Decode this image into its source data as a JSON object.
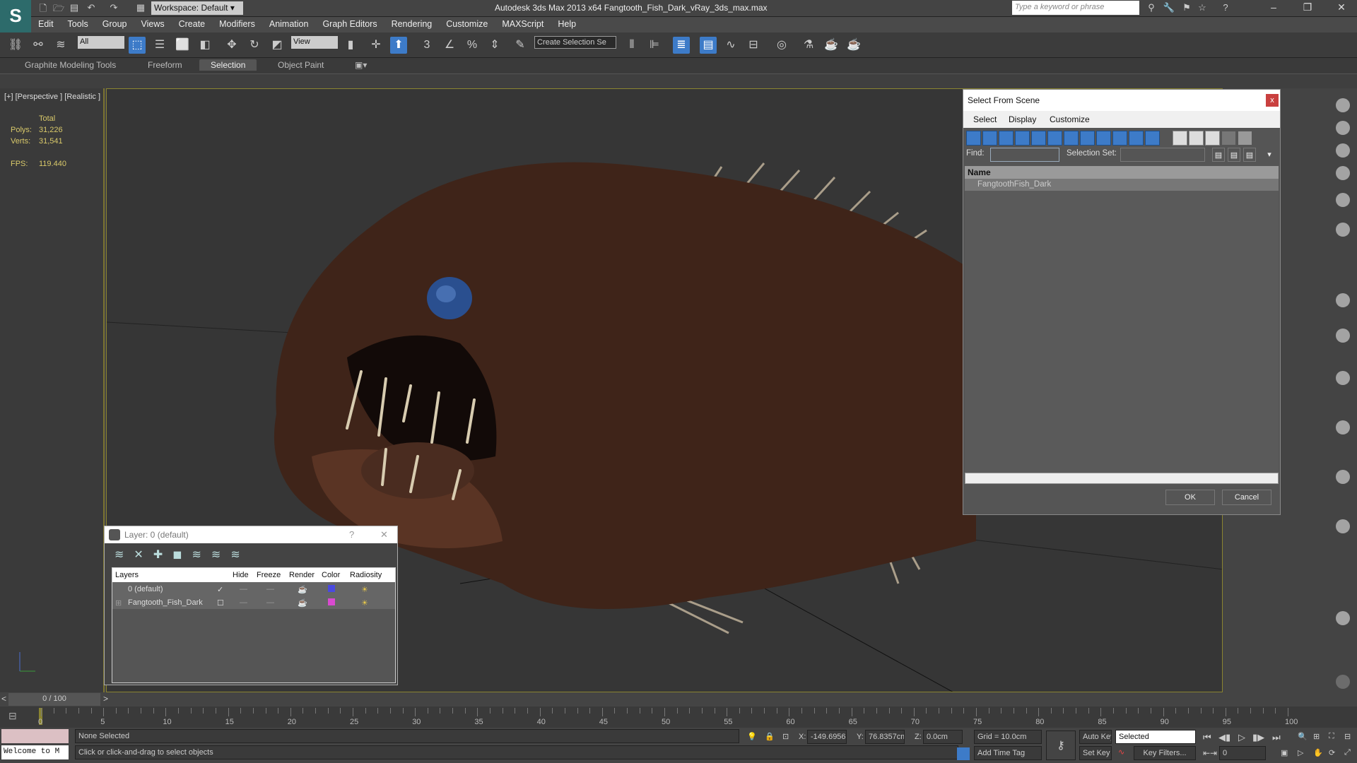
{
  "titlebar": {
    "workspace": "Workspace: Default",
    "title": "Autodesk 3ds Max  2013 x64     Fangtooth_Fish_Dark_vRay_3ds_max.max",
    "search_placeholder": "Type a keyword or phrase"
  },
  "menu": [
    "Edit",
    "Tools",
    "Group",
    "Views",
    "Create",
    "Modifiers",
    "Animation",
    "Graph Editors",
    "Rendering",
    "Customize",
    "MAXScript",
    "Help"
  ],
  "toolbar": {
    "filter": "All",
    "ref_coord": "View",
    "selection_set": "Create Selection Se"
  },
  "ribbon": {
    "tabs": [
      "Graphite Modeling Tools",
      "Freeform",
      "Selection",
      "Object Paint"
    ],
    "active": "Selection"
  },
  "viewport": {
    "label": "[+] [Perspective ] [Realistic ]",
    "stats": {
      "total": "Total",
      "polys_label": "Polys:",
      "polys": "31,226",
      "verts_label": "Verts:",
      "verts": "31,541",
      "fps_label": "FPS:",
      "fps": "119.440"
    }
  },
  "select_from_scene": {
    "title": "Select From Scene",
    "close": "x",
    "menu": [
      "Select",
      "Display",
      "Customize"
    ],
    "find_label": "Find:",
    "find_value": "",
    "selset_label": "Selection Set:",
    "column": "Name",
    "items": [
      "FangtoothFish_Dark"
    ],
    "ok": "OK",
    "cancel": "Cancel"
  },
  "layer_dialog": {
    "title": "Layer: 0 (default)",
    "help": "?",
    "close": "✕",
    "columns": [
      "Layers",
      "Hide",
      "Freeze",
      "Render",
      "Color",
      "Radiosity"
    ],
    "rows": [
      {
        "name": "0 (default)",
        "current": "✓",
        "color": "#4a4adf"
      },
      {
        "name": "Fangtooth_Fish_Dark",
        "current": "☐",
        "color": "#d94ad0"
      }
    ]
  },
  "timeline": {
    "frame": "0 / 100",
    "ticks": [
      "0",
      "5",
      "10",
      "15",
      "20",
      "25",
      "30",
      "35",
      "40",
      "45",
      "50",
      "55",
      "60",
      "65",
      "70",
      "75",
      "80",
      "85",
      "90",
      "95",
      "100"
    ]
  },
  "status": {
    "maxscript": "Welcome to M",
    "selection": "None Selected",
    "prompt": "Click or click-and-drag to select objects",
    "x_label": "X:",
    "x": "-149.6956",
    "y_label": "Y:",
    "y": "76.8357cm",
    "z_label": "Z:",
    "z": "0.0cm",
    "grid": "Grid = 10.0cm",
    "add_time_tag": "Add Time Tag",
    "auto_key": "Auto Key",
    "set_key": "Set Key",
    "key_mode": "Selected",
    "key_filters": "Key Filters...",
    "current_frame": "0"
  }
}
